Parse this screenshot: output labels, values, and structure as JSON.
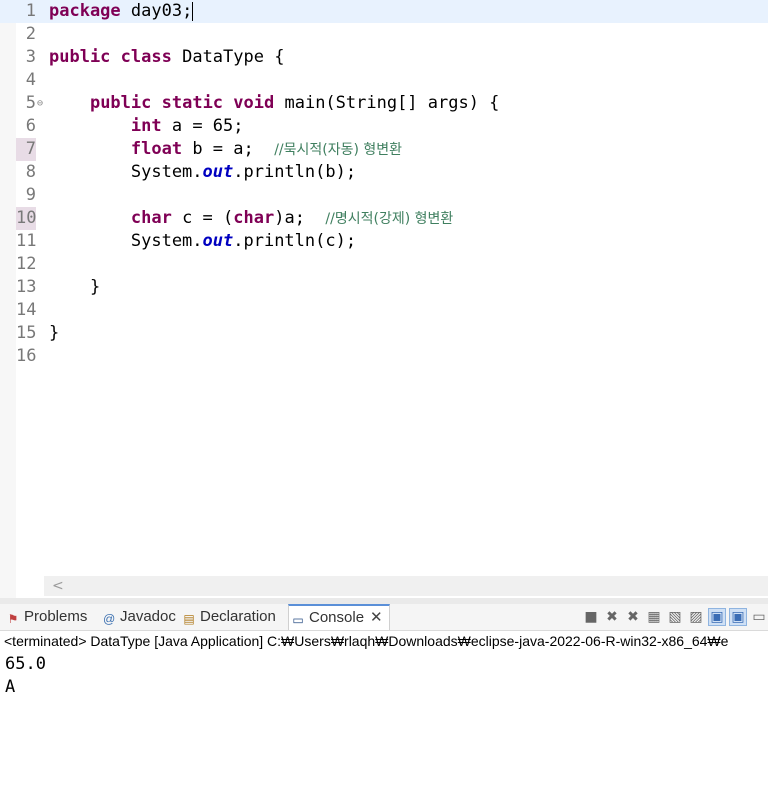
{
  "editor": {
    "lines": [
      {
        "n": "1",
        "segs": [
          {
            "t": "package",
            "c": "kw"
          },
          {
            "t": " day03;"
          }
        ],
        "current": true,
        "caret": true
      },
      {
        "n": "2",
        "segs": []
      },
      {
        "n": "3",
        "segs": [
          {
            "t": "public",
            "c": "kw"
          },
          {
            "t": " "
          },
          {
            "t": "class",
            "c": "kw"
          },
          {
            "t": " DataType {"
          }
        ]
      },
      {
        "n": "4",
        "segs": []
      },
      {
        "n": "5",
        "segs": [
          {
            "t": "    "
          },
          {
            "t": "public",
            "c": "kw"
          },
          {
            "t": " "
          },
          {
            "t": "static",
            "c": "kw"
          },
          {
            "t": " "
          },
          {
            "t": "void",
            "c": "kw"
          },
          {
            "t": " main(String[] args) {"
          }
        ],
        "fold": "⊖"
      },
      {
        "n": "6",
        "segs": [
          {
            "t": "        "
          },
          {
            "t": "int",
            "c": "kw"
          },
          {
            "t": " a = 65;"
          }
        ]
      },
      {
        "n": "7",
        "segs": [
          {
            "t": "        "
          },
          {
            "t": "float",
            "c": "kw"
          },
          {
            "t": " b = a;  "
          },
          {
            "t": "//묵시적(자동) 형변환",
            "c": "cm"
          }
        ],
        "mod": true
      },
      {
        "n": "8",
        "segs": [
          {
            "t": "        System."
          },
          {
            "t": "out",
            "c": "fld"
          },
          {
            "t": ".println(b);"
          }
        ]
      },
      {
        "n": "9",
        "segs": []
      },
      {
        "n": "10",
        "segs": [
          {
            "t": "        "
          },
          {
            "t": "char",
            "c": "kw"
          },
          {
            "t": " c = ("
          },
          {
            "t": "char",
            "c": "kw"
          },
          {
            "t": ")a;  "
          },
          {
            "t": "//명시적(강제) 형변환",
            "c": "cm"
          }
        ],
        "mod": true
      },
      {
        "n": "11",
        "segs": [
          {
            "t": "        System."
          },
          {
            "t": "out",
            "c": "fld"
          },
          {
            "t": ".println(c);"
          }
        ]
      },
      {
        "n": "12",
        "segs": []
      },
      {
        "n": "13",
        "segs": [
          {
            "t": "    }"
          }
        ]
      },
      {
        "n": "14",
        "segs": []
      },
      {
        "n": "15",
        "segs": [
          {
            "t": "}"
          }
        ]
      },
      {
        "n": "16",
        "segs": []
      }
    ],
    "scroll_left_arrow": "<"
  },
  "tabs": [
    {
      "label": "Problems",
      "icon": "problems-icon",
      "glyph": "⚑"
    },
    {
      "label": "Javadoc",
      "icon": "javadoc-icon",
      "glyph": "@"
    },
    {
      "label": "Declaration",
      "icon": "declaration-icon",
      "glyph": "▤"
    },
    {
      "label": "Console",
      "icon": "console-icon",
      "glyph": "▭",
      "active": true
    }
  ],
  "console": {
    "close_glyph": "✕",
    "status": "<terminated> DataType [Java Application] C:₩Users₩rlaqh₩Downloads₩eclipse-java-2022-06-R-win32-x86_64₩e",
    "output": [
      "65.0",
      "A"
    ]
  },
  "toolbar": {
    "tools": [
      {
        "name": "terminate-icon",
        "glyph": "■"
      },
      {
        "name": "remove-launch-icon",
        "glyph": "✖"
      },
      {
        "name": "remove-all-icon",
        "glyph": "✖"
      },
      {
        "name": "clear-console-icon",
        "glyph": "▦"
      },
      {
        "name": "scroll-lock-icon",
        "glyph": "▧"
      },
      {
        "name": "word-wrap-icon",
        "glyph": "▨"
      },
      {
        "name": "show-on-output-icon",
        "glyph": "▣",
        "on": true
      },
      {
        "name": "show-on-error-icon",
        "glyph": "▣",
        "on": true
      },
      {
        "name": "display-console-icon",
        "glyph": "▭"
      }
    ]
  }
}
